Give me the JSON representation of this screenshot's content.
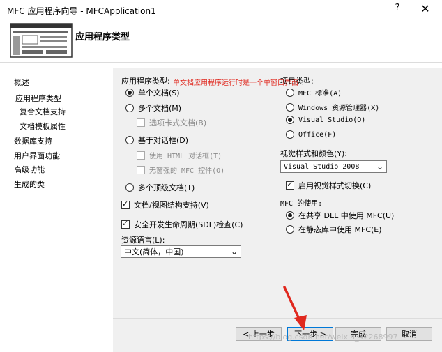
{
  "window": {
    "title": "MFC 应用程序向导 - MFCApplication1",
    "help": "?",
    "close": "✕"
  },
  "header": {
    "page_title": "应用程序类型"
  },
  "nav": {
    "items": [
      {
        "label": "概述"
      },
      {
        "label": "应用程序类型"
      },
      {
        "label": "复合文档支持"
      },
      {
        "label": "文档模板属性"
      },
      {
        "label": "数据库支持"
      },
      {
        "label": "用户界面功能"
      },
      {
        "label": "高级功能"
      },
      {
        "label": "生成的类"
      }
    ]
  },
  "app_type": {
    "label": "应用程序类型:",
    "annotation": "单文档应用程序运行时是一个单窗口界面",
    "options": {
      "single": "单个文档(S)",
      "multi": "多个文档(M)",
      "tabbed": "选项卡式文档(B)",
      "dialog": "基于对话框(D)",
      "html_dialog": "使用 HTML 对话框(T)",
      "no_frame": "无窗强的 MFC 控件(O)",
      "top_level": "多个顶级文档(T)"
    },
    "selected": "single",
    "doc_view": "文档/视图结构支持(V)",
    "sdl": "安全开发生命周期(SDL)检查(C)"
  },
  "resource_language": {
    "label": "资源语言(L):",
    "value": "中文(简体，中国)"
  },
  "project_type": {
    "label": "项目类型:",
    "options": {
      "mfc_standard": "MFC 标准(A)",
      "explorer": "Windows 资源管理器(X)",
      "visual_studio": "Visual Studio(O)",
      "office": "Office(F)"
    },
    "selected": "visual_studio"
  },
  "visual_style": {
    "label": "视觉样式和颜色(Y):",
    "value": "Visual Studio 2008",
    "switch_label": "启用视觉样式切换(C)"
  },
  "mfc_use": {
    "label": "MFC 的使用:",
    "options": {
      "shared": "在共享 DLL 中使用 MFC(U)",
      "static": "在静态库中使用 MFC(E)"
    },
    "selected": "shared"
  },
  "footer": {
    "back": "< 上一步",
    "next": "下一步 >",
    "finish": "完成",
    "cancel": "取消",
    "watermark": "https://blog.csdn.net/weixin_42268997"
  },
  "colors": {
    "annotation": "#e0281e",
    "arrow": "#e0281e",
    "panel": "#f0f0f0"
  }
}
